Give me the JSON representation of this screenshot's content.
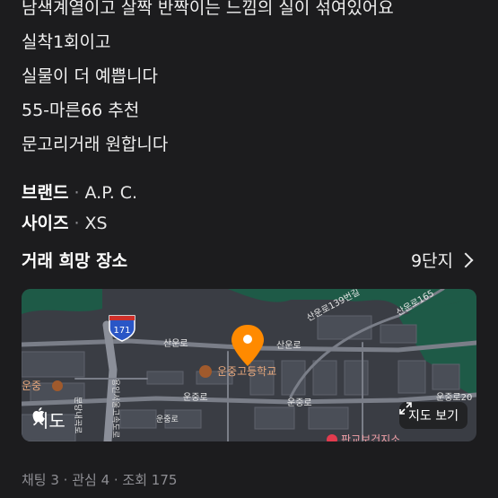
{
  "description": {
    "lines": [
      "남색계열이고 살짝 반짝이는 느낌의 실이 섞여있어요",
      "실착1회이고",
      "실물이 더 예쁩니다",
      "55-마른66 추천",
      "문고리거래 원합니다"
    ]
  },
  "attributes": {
    "brand": {
      "label": "브랜드",
      "value": "A.P. C."
    },
    "size": {
      "label": "사이즈",
      "value": "XS"
    },
    "separator": "·"
  },
  "trade_place": {
    "title": "거래 희망 장소",
    "value": "9단지"
  },
  "map": {
    "brand": "지도",
    "open_button": "지도 보기",
    "labels": {
      "highway": "171",
      "road1": "산운로",
      "road2": "산운로",
      "road3": "운중로",
      "road4": "운중로",
      "road5": "운중로",
      "road6": "산운로139번길",
      "road7": "산운로165",
      "road8": "분당내곡로",
      "road9": "운중로20",
      "school": "운중고등학교",
      "school2": "운중",
      "place_bottom": "판교보건지소",
      "highway_side": "용인서울고속도로"
    },
    "colors": {
      "pin": "#ff8a00",
      "park": "#1e5a47",
      "road": "#6b6f78"
    }
  },
  "stats": {
    "text": "채팅 3 · 관심 4 · 조회 175"
  }
}
